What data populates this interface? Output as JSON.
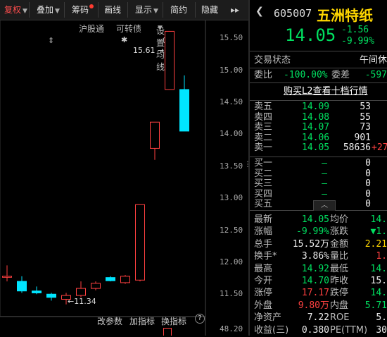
{
  "toolbar": {
    "items": [
      "复权",
      "叠加",
      "筹码",
      "画线",
      "显示",
      "简约",
      "隐藏"
    ],
    "more": "▸▸"
  },
  "subbar": {
    "hgt": "沪股通",
    "kzz": "可转债",
    "setting": "设置均线"
  },
  "axis": {
    "ticks": [
      "15.50",
      "15.00",
      "14.50",
      "14.00",
      "13.50",
      "13.00",
      "12.50",
      "12.00",
      "11.50"
    ],
    "vol_tick": "48.20"
  },
  "annotations": {
    "high": "15.61",
    "low": "11.34"
  },
  "bottombar": {
    "change_param": "改参数",
    "add_indicator": "加指标",
    "switch_indicator": "换指标",
    "help": "?"
  },
  "stock": {
    "code": "605007",
    "name": "五洲特纸",
    "price": "14.05",
    "change": "-1.56",
    "change_pct": "-9.99%"
  },
  "status": {
    "label": "交易状态",
    "value": "午间休"
  },
  "weibi": {
    "label": "委比",
    "value": "-100.00%",
    "label2": "委差",
    "value2": "-597"
  },
  "l2_link": "购买L2查看十档行情",
  "sell": [
    {
      "label": "卖五",
      "price": "14.09",
      "vol": "53"
    },
    {
      "label": "卖四",
      "price": "14.08",
      "vol": "55"
    },
    {
      "label": "卖三",
      "price": "14.07",
      "vol": "73"
    },
    {
      "label": "卖二",
      "price": "14.06",
      "vol": "901"
    },
    {
      "label": "卖一",
      "price": "14.05",
      "vol": "58636",
      "extra": "+27"
    }
  ],
  "buy": [
    {
      "label": "买一",
      "price": "—",
      "vol": "0"
    },
    {
      "label": "买二",
      "price": "—",
      "vol": "0"
    },
    {
      "label": "买三",
      "price": "—",
      "vol": "0"
    },
    {
      "label": "买四",
      "price": "—",
      "vol": "0"
    },
    {
      "label": "买五",
      "price": "—",
      "vol": "0"
    }
  ],
  "stats": [
    {
      "l1": "最新",
      "v1": "14.05",
      "c1": "green",
      "l2": "均价",
      "v2": "14.",
      "c2": "green"
    },
    {
      "l1": "涨幅",
      "v1": "-9.99%",
      "c1": "green",
      "l2": "涨跌",
      "v2": "▼1.",
      "c2": "green"
    },
    {
      "l1": "总手",
      "v1": "15.52万",
      "c1": "white",
      "l2": "金额",
      "v2": "2.21",
      "c2": "yellow"
    },
    {
      "l1": "换手*",
      "v1": "3.86%",
      "c1": "white",
      "l2": "量比",
      "v2": "1.",
      "c2": "red"
    },
    {
      "l1": "最高",
      "v1": "14.92",
      "c1": "green",
      "l2": "最低",
      "v2": "14.",
      "c2": "green"
    },
    {
      "l1": "今开",
      "v1": "14.70",
      "c1": "green",
      "l2": "昨收",
      "v2": "15.",
      "c2": "white"
    },
    {
      "l1": "涨停",
      "v1": "17.17",
      "c1": "red",
      "l2": "跌停",
      "v2": "14.",
      "c2": "green"
    },
    {
      "l1": "外盘",
      "v1": "9.80万",
      "c1": "red",
      "l2": "内盘",
      "v2": "5.71",
      "c2": "green"
    },
    {
      "l1": "净资产",
      "v1": "7.22",
      "c1": "white",
      "l2": "ROE",
      "v2": "5.",
      "c2": "white"
    },
    {
      "l1": "收益(三)",
      "v1": "0.380",
      "c1": "white",
      "l2": "PE(TTM)",
      "v2": "30",
      "c2": "white"
    }
  ],
  "chart_data": {
    "type": "candlestick",
    "ylim": [
      11.15,
      15.78
    ],
    "candles": [
      {
        "o": 11.78,
        "c": 11.78,
        "h": 11.95,
        "l": 11.7,
        "color": "red"
      },
      {
        "o": 11.7,
        "c": 11.55,
        "h": 11.78,
        "l": 11.52,
        "color": "cyan"
      },
      {
        "o": 11.55,
        "c": 11.52,
        "h": 11.62,
        "l": 11.5,
        "color": "cyan"
      },
      {
        "o": 11.5,
        "c": 11.45,
        "h": 11.52,
        "l": 11.4,
        "color": "cyan"
      },
      {
        "o": 11.42,
        "c": 11.48,
        "h": 11.52,
        "l": 11.34,
        "color": "red"
      },
      {
        "o": 11.48,
        "c": 11.59,
        "h": 11.7,
        "l": 11.45,
        "color": "red"
      },
      {
        "o": 11.59,
        "c": 11.67,
        "h": 11.7,
        "l": 11.56,
        "color": "red"
      },
      {
        "o": 11.76,
        "c": 11.71,
        "h": 11.78,
        "l": 11.7,
        "color": "cyan"
      },
      {
        "o": 11.68,
        "c": 11.78,
        "h": 11.8,
        "l": 11.66,
        "color": "red"
      },
      {
        "o": 11.72,
        "c": 12.9,
        "h": 12.9,
        "l": 11.7,
        "color": "red"
      },
      {
        "o": 13.78,
        "c": 14.19,
        "h": 14.19,
        "l": 13.6,
        "color": "red"
      },
      {
        "o": 14.7,
        "c": 15.61,
        "h": 15.61,
        "l": 14.7,
        "color": "red"
      },
      {
        "o": 14.7,
        "c": 14.05,
        "h": 14.92,
        "l": 14.05,
        "color": "cyan"
      }
    ]
  }
}
